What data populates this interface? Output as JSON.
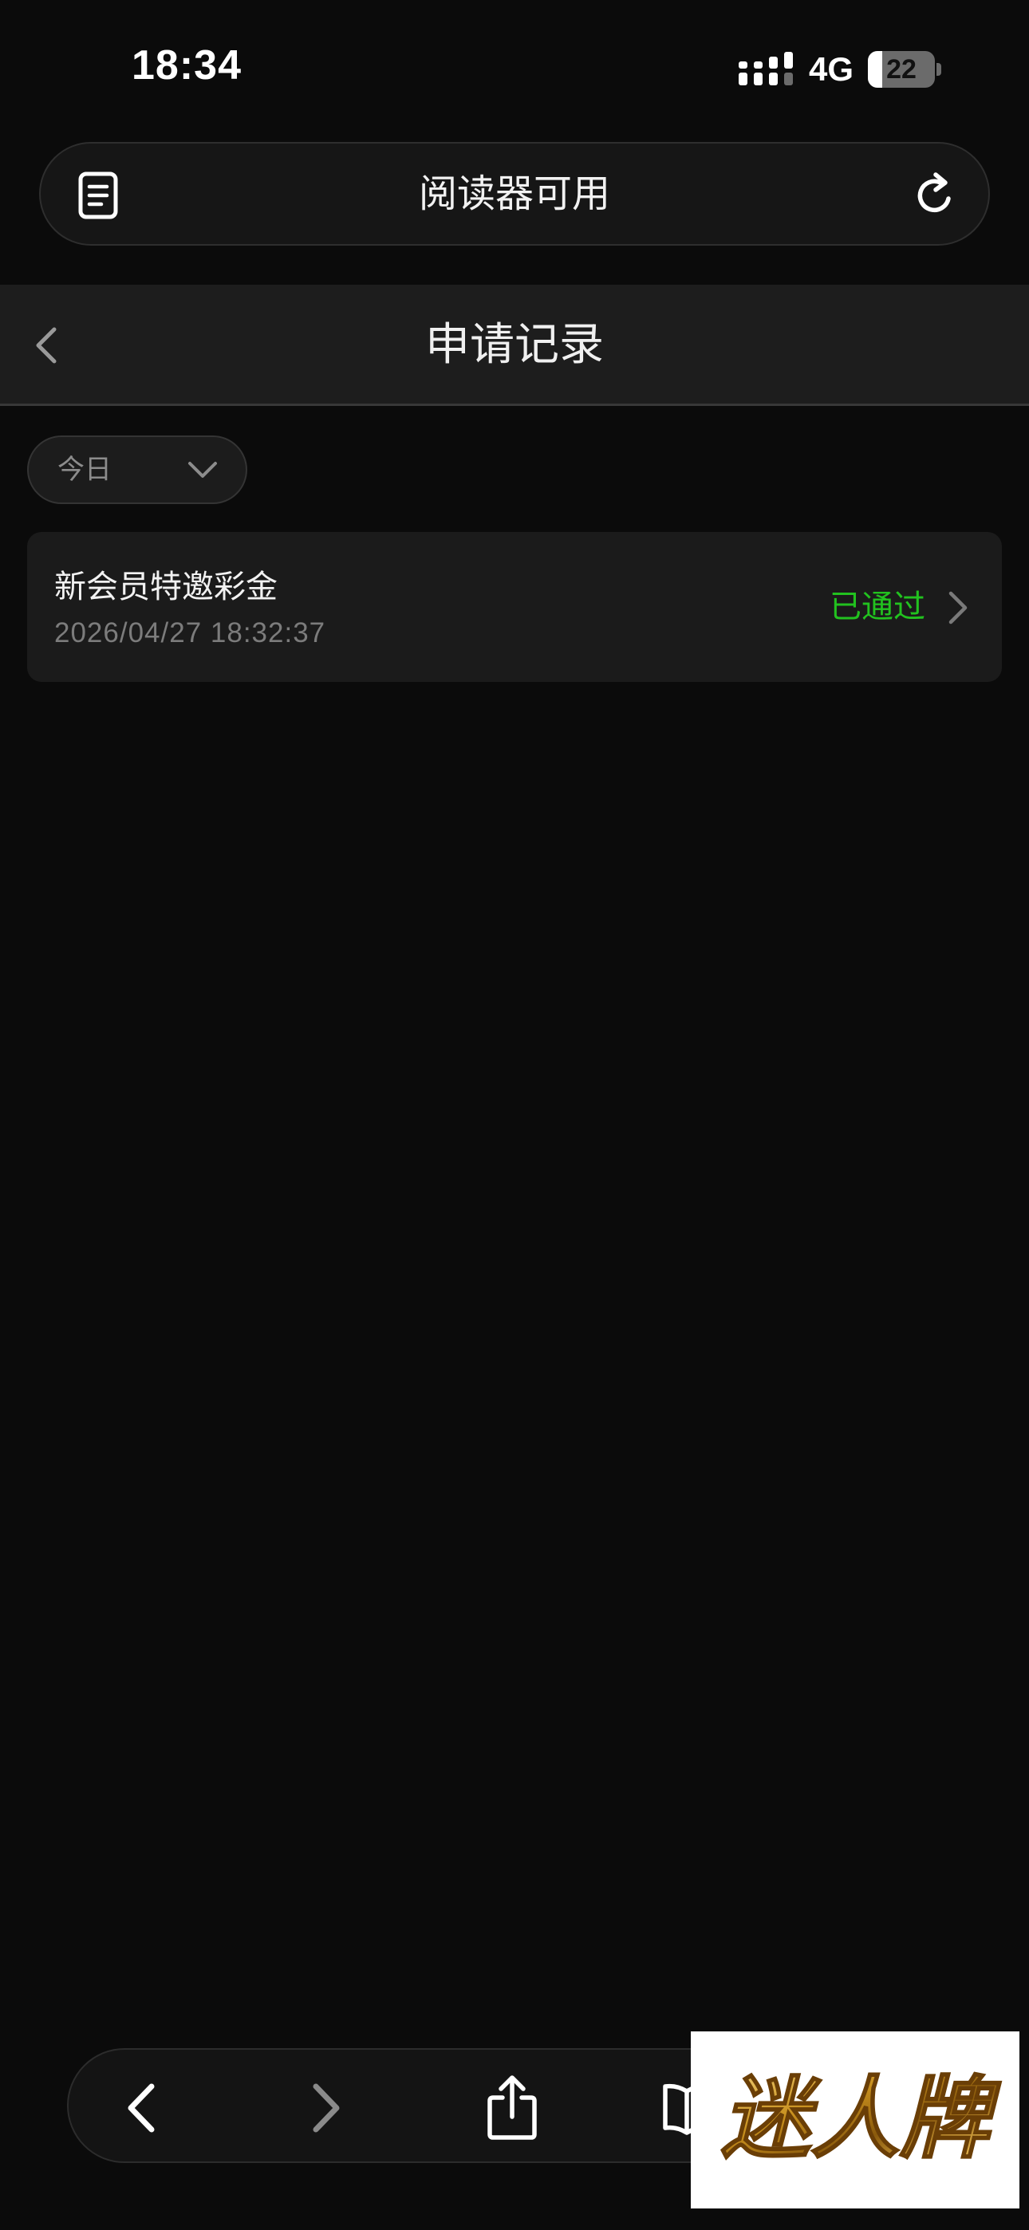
{
  "status_bar": {
    "time": "18:34",
    "network": "4G",
    "battery_level": "22"
  },
  "address_bar": {
    "text": "阅读器可用",
    "left_icon": "reader-icon",
    "right_icon": "reload-icon"
  },
  "header": {
    "title": "申请记录",
    "back_icon": "chevron-left-icon"
  },
  "filter": {
    "date_range": "今日",
    "icon": "chevron-down-icon"
  },
  "records": [
    {
      "title": "新会员特邀彩金",
      "time": "2026/04/27 18:32:37",
      "status": "已通过"
    }
  ],
  "toolbar": {
    "icons": [
      "back-icon",
      "forward-icon",
      "share-icon",
      "bookmarks-icon"
    ]
  },
  "watermark": {
    "text": "迷人牌"
  },
  "colors": {
    "background": "#0b0b0b",
    "header_bg": "#1d1d1d",
    "card_bg": "#1b1b1b",
    "status_approved": "#22c21f",
    "watermark_gold": "#c8901e"
  }
}
